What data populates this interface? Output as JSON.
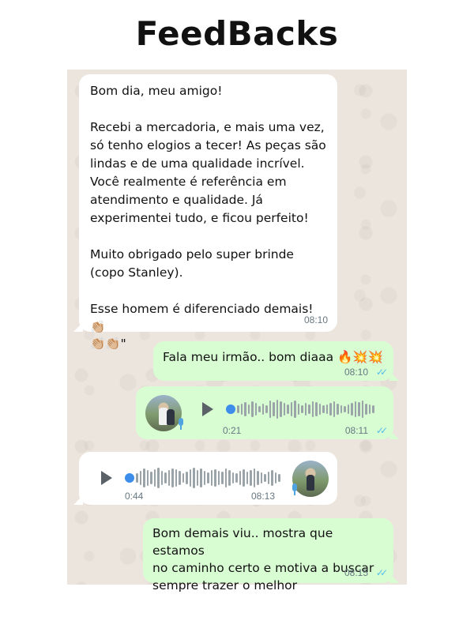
{
  "page": {
    "title": "FeedBacks"
  },
  "messages": {
    "m1": {
      "text": "Bom dia, meu amigo!\n\nRecebi a mercadoria, e mais uma vez, só tenho elogios a tecer! As peças são lindas e de uma qualidade incrível. Você realmente é referência em atendimento e qualidade. Já experimentei tudo, e ficou perfeito!\n\nMuito obrigado pelo super brinde (copo Stanley).\n\nEsse homem é diferenciado demais! 👏🏼",
      "text_tail": "👏🏼👏🏼\"",
      "time": "08:10"
    },
    "m2": {
      "text": "Fala meu irmão.. bom diaaa 🔥💥💥",
      "time": "08:10"
    },
    "m3": {
      "duration": "0:21",
      "time": "08:11"
    },
    "m4": {
      "duration": "0:44",
      "time": "08:13"
    },
    "m5": {
      "text": "Bom demais viu.. mostra que estamos\nno caminho certo e motiva a buscar\nsempre trazer o melhor",
      "time": "08:15"
    }
  },
  "icons": {
    "read_receipt": "double-check-icon",
    "play": "play-icon",
    "mic": "mic-icon"
  },
  "colors": {
    "incoming": "#ffffff",
    "outgoing": "#d9fdd3",
    "wallpaper": "#ece5dd",
    "read": "#53bdeb",
    "voice_dot": "#3d8eea"
  }
}
